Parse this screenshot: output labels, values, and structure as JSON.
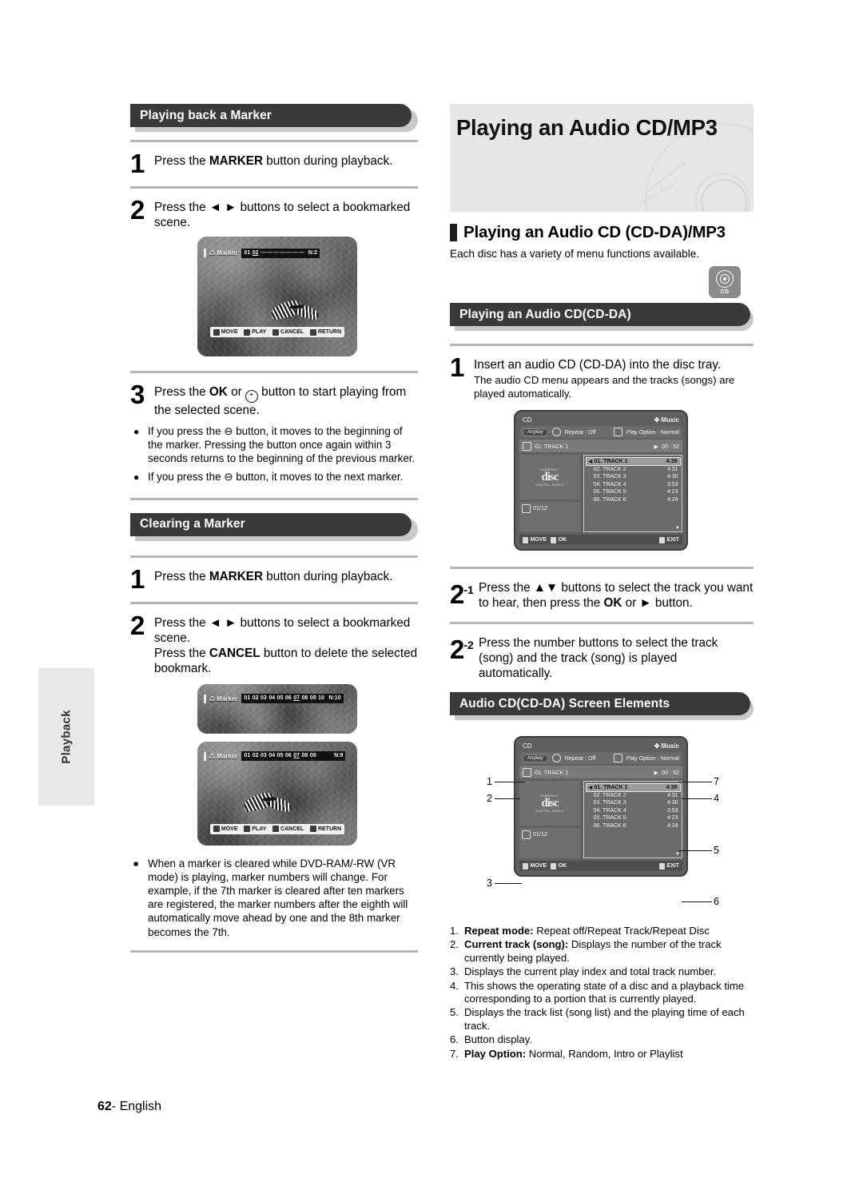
{
  "side_tab": {
    "label": "Playback"
  },
  "footer": {
    "page": "62",
    "dash": "- ",
    "language": "English"
  },
  "left": {
    "section1": {
      "title": "Playing back a Marker"
    },
    "steps1": [
      {
        "num": "1",
        "text_before": "Press the ",
        "bold": "MARKER",
        "text_after": " button during playback."
      },
      {
        "num": "2",
        "text_before": "Press the ",
        "bold": "◄ ►",
        "text_after": " buttons to select a bookmarked scene."
      }
    ],
    "screen1": {
      "label": "Marker",
      "markers": [
        "01",
        "02"
      ],
      "current": "02",
      "dashes": 7,
      "total": "N:2",
      "buttons": [
        "MOVE",
        "PLAY",
        "CANCEL",
        "RETURN"
      ]
    },
    "step3": {
      "num": "3",
      "t1": "Press the ",
      "b1": "OK",
      "t2": " or ",
      "icon": "jump-button-icon",
      "t3": " button to start playing from the selected scene."
    },
    "bullets": [
      "If you press the ⊖ button, it moves to the beginning of the marker. Pressing the button once again within 3 seconds returns to the beginning of the previous marker.",
      "If you press the ⊖ button, it moves to the next marker."
    ],
    "section2": {
      "title": "Clearing a Marker"
    },
    "steps2": [
      {
        "num": "1",
        "text_before": "Press the ",
        "bold": "MARKER",
        "text_after": " button during playback."
      },
      {
        "num": "2",
        "text_before": "Press the ",
        "bold": "◄ ►",
        "text_after": " buttons to select a bookmarked scene.",
        "line2_before": "Press the ",
        "line2_bold": "CANCEL",
        "line2_after": " button to delete the selected bookmark."
      }
    ],
    "screen2": {
      "label": "Marker",
      "markers": [
        "01",
        "02",
        "03",
        "04",
        "05",
        "06",
        "07",
        "08",
        "09",
        "10"
      ],
      "current": "07",
      "total": "N:10"
    },
    "screen3": {
      "label": "Marker",
      "markers": [
        "01",
        "02",
        "03",
        "04",
        "05",
        "06",
        "07",
        "08",
        "09"
      ],
      "current": "07",
      "total": "N:9",
      "buttons": [
        "MOVE",
        "PLAY",
        "CANCEL",
        "RETURN"
      ]
    },
    "note": "When a marker is cleared while DVD-RAM/-RW (VR mode) is playing, marker numbers will change. For example, if the 7th marker is cleared after ten markers are registered, the marker numbers after the eighth will automatically move ahead by one and the 8th marker becomes the 7th."
  },
  "right": {
    "banner_title": "Playing an Audio CD/MP3",
    "heading2": "Playing an Audio CD (CD-DA)/MP3",
    "lead": "Each disc has a variety of menu functions available.",
    "disc_badge": {
      "caption": "CD"
    },
    "section1": {
      "title": "Playing an Audio CD(CD-DA)"
    },
    "step1": {
      "num": "1",
      "text": "Insert an audio CD (CD-DA) into the disc tray.",
      "sub": "The audio CD menu appears and the tracks (songs) are played automatically."
    },
    "cd_screen": {
      "title": "CD",
      "mode_label": "Music",
      "mode_star": "✤",
      "pill": "Anykey",
      "repeat": "Repeat : Off",
      "play_option": "Play Option : Normal",
      "now_playing": "01. TRACK 1",
      "elapsed": "00 : 52",
      "play_icon": "▶",
      "disc_logo": {
        "top": "COMPACT",
        "mid": "disc",
        "bottom": "DIGITAL AUDIO"
      },
      "index": "01/12",
      "tracks": [
        {
          "no": "01. TRACK 1",
          "time": "4:39"
        },
        {
          "no": "02. TRACK 2",
          "time": "4:31"
        },
        {
          "no": "03. TRACK 3",
          "time": "4:30"
        },
        {
          "no": "04. TRACK 4",
          "time": "3:53"
        },
        {
          "no": "05. TRACK 5",
          "time": "4:23"
        },
        {
          "no": "06. TRACK 6",
          "time": "4:24"
        }
      ],
      "buttons": [
        "MOVE",
        "OK",
        "EXIT"
      ]
    },
    "step21": {
      "num": "2",
      "sup": "-1",
      "t1": "Press the ",
      "b1": "▲▼",
      "t2": " buttons to select the track you want to hear,  then press the ",
      "b2": "OK",
      "t3": " or ",
      "b3": "►",
      "t4": " button."
    },
    "step22": {
      "num": "2",
      "sup": "-2",
      "text": "Press the number buttons to select the track (song) and the track (song) is played automatically."
    },
    "section2": {
      "title": "Audio CD(CD-DA) Screen Elements"
    },
    "callouts": [
      "1",
      "2",
      "3",
      "4",
      "5",
      "6",
      "7"
    ],
    "descriptions": [
      {
        "n": "1.",
        "bold": "Repeat mode:",
        "text": " Repeat off/Repeat Track/Repeat Disc"
      },
      {
        "n": "2.",
        "bold": "Current track (song):",
        "text": " Displays the number of the track currently being played."
      },
      {
        "n": "3.",
        "bold": "",
        "text": "Displays the current play index and total track number."
      },
      {
        "n": "4.",
        "bold": "",
        "text": "This shows the operating state of a disc and a playback time corresponding to a portion that is currently played."
      },
      {
        "n": "5.",
        "bold": "",
        "text": "Displays the track list (song list) and the playing time of each track."
      },
      {
        "n": "6.",
        "bold": "",
        "text": "Button display."
      },
      {
        "n": "7.",
        "bold": "Play Option:",
        "text": " Normal, Random, Intro or Playlist"
      }
    ]
  }
}
